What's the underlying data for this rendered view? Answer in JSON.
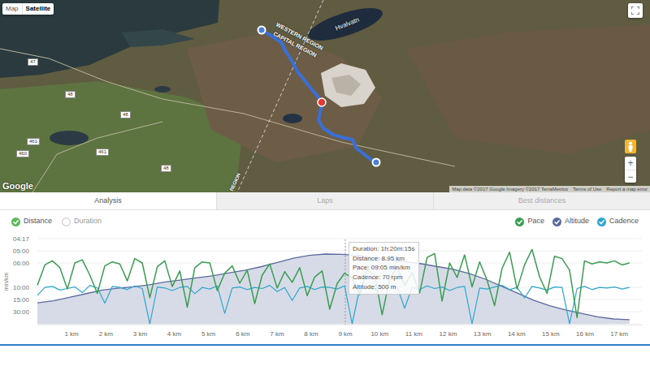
{
  "map": {
    "type_buttons": [
      {
        "label": "Map",
        "selected": false
      },
      {
        "label": "Satellite",
        "selected": true
      }
    ],
    "labels": [
      "WESTERN REGION",
      "CAPITAL REGION",
      "Hvalvatn",
      "REGION"
    ],
    "road_numbers": [
      "47",
      "48",
      "48",
      "461",
      "460",
      "461",
      "48"
    ],
    "logo": "Google",
    "attribution": [
      "Map data ©2017 Google Imagery ©2017 TerraMetrics",
      "Terms of Use",
      "Report a map error"
    ],
    "zoom": [
      "+",
      "−"
    ]
  },
  "tabs": [
    {
      "label": "Analysis",
      "selected": true
    },
    {
      "label": "Laps",
      "selected": false
    },
    {
      "label": "Best distances",
      "selected": false
    }
  ],
  "x_axis_options": [
    {
      "label": "Distance",
      "selected": true
    },
    {
      "label": "Duration",
      "selected": false
    }
  ],
  "series_toggles": [
    {
      "label": "Pace",
      "checked": true,
      "color": "#3a9e52"
    },
    {
      "label": "Altitude",
      "checked": true,
      "color": "#5b6a9c"
    },
    {
      "label": "Cadence",
      "checked": true,
      "color": "#2ca6cc"
    }
  ],
  "chart": {
    "y_axis_title": "min/km",
    "y_ticks": [
      "04:17",
      "05:00",
      "06:00",
      "10:00",
      "15:00",
      "30:00"
    ],
    "x_ticks": [
      "1 km",
      "2 km",
      "3 km",
      "4 km",
      "5 km",
      "6 km",
      "7 km",
      "8 km",
      "9 km",
      "10 km",
      "11 km",
      "12 km",
      "13 km",
      "14 km",
      "15 km",
      "16 km",
      "17 km"
    ],
    "pace": [
      9.5,
      6.2,
      5.8,
      6.5,
      10.5,
      6.0,
      5.7,
      7.5,
      12,
      6.3,
      5.9,
      6.1,
      8.5,
      5.6,
      6.0,
      14,
      6.4,
      5.8,
      9.8,
      6.9,
      22,
      6.5,
      5.9,
      6.0,
      11,
      7.2,
      6.3,
      9.0,
      6.8,
      18,
      7.5,
      6.1,
      10.2,
      7.0,
      8.8,
      6.5,
      13,
      7.8,
      6.9,
      25,
      9.05,
      7.2,
      8.0,
      12.5,
      6.8,
      7.5,
      40,
      8.2,
      6.4,
      9.5,
      7.1,
      11.8,
      5.5,
      5.2,
      16,
      6.0,
      7.9,
      5.3,
      9.9,
      5.9,
      8.4,
      20,
      6.6,
      5.1,
      10.5,
      6.2,
      4.9,
      7.8,
      12,
      5.4,
      5.6,
      6.8,
      60,
      5.8,
      6.1,
      5.9,
      6.0,
      5.8,
      6.2,
      6.0
    ],
    "cadence": [
      55,
      70,
      72,
      65,
      68,
      71,
      60,
      74,
      69,
      40,
      72,
      70,
      66,
      73,
      68,
      0,
      71,
      69,
      64,
      70,
      72,
      58,
      70,
      67,
      73,
      20,
      69,
      71,
      66,
      70,
      68,
      74,
      62,
      70,
      45,
      69,
      72,
      66,
      71,
      70,
      67,
      73,
      0,
      68,
      70,
      65,
      72,
      69,
      71,
      30,
      70,
      66,
      73,
      68,
      71,
      64,
      70,
      72,
      0,
      69,
      67,
      71,
      74,
      66,
      70,
      50,
      72,
      69,
      65,
      71,
      70,
      0,
      68,
      72,
      66,
      70,
      69,
      71,
      67,
      70
    ],
    "altitude": [
      150,
      165,
      190,
      215,
      240,
      255,
      265,
      280,
      300,
      315,
      330,
      345,
      365,
      385,
      410,
      440,
      470,
      490,
      500,
      498,
      490,
      475,
      460,
      445,
      430,
      410,
      390,
      360,
      320,
      270,
      220,
      170,
      130,
      100,
      75,
      50,
      35,
      30
    ],
    "tooltip": [
      "Duration: 1h:20m:15s",
      "Distance: 8.95 km",
      "Pace: 09:05 min/km",
      "Cadence: 70 rpm",
      "Altitude: 500 m"
    ]
  }
}
